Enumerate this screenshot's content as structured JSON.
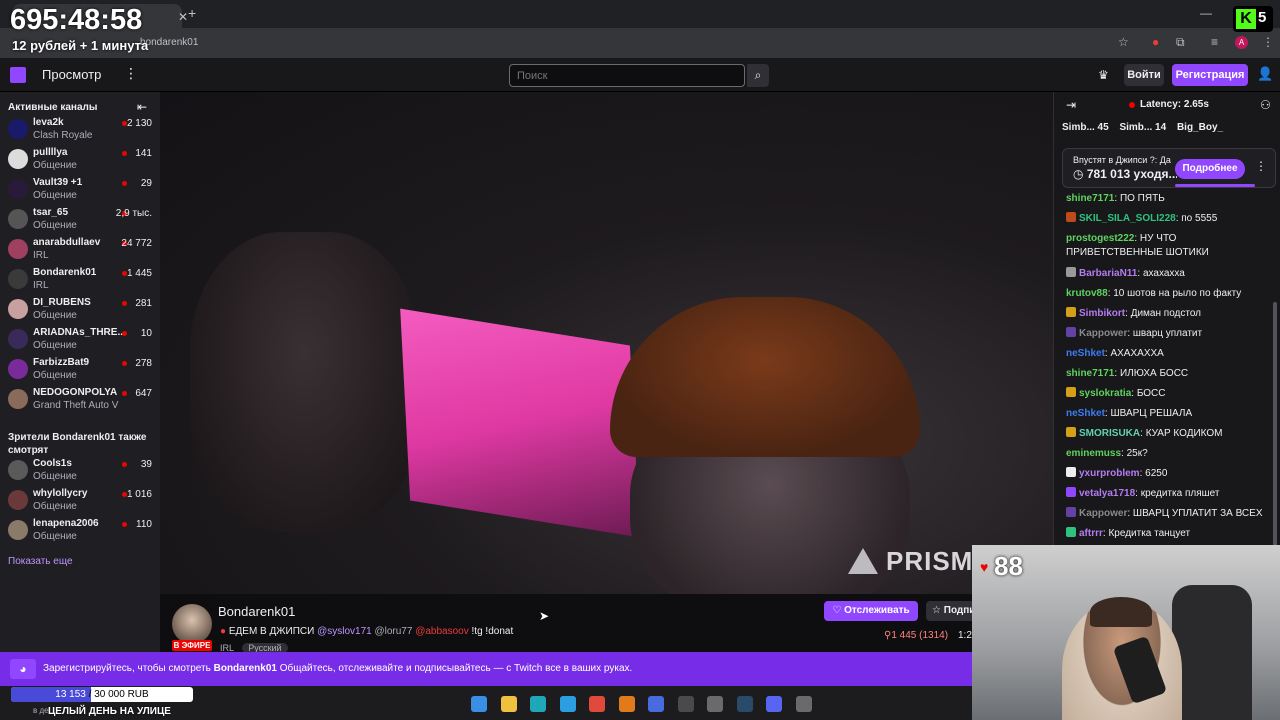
{
  "overlay": {
    "timer": "695:48:58",
    "rate": "12 рублей + 1 минута",
    "kick_count": "5",
    "kick_logo": "K",
    "likes": "88"
  },
  "browser": {
    "url": "bondarenk01",
    "icons": [
      "star-icon",
      "extension-icon",
      "puzzle-icon",
      "menu-icon"
    ],
    "avatar": "A"
  },
  "nav": {
    "browse": "Просмотр",
    "search_placeholder": "Поиск",
    "login": "Войти",
    "signup": "Регистрация"
  },
  "sidebar": {
    "title": "Активные каналы",
    "channels": [
      {
        "name": "leva2k",
        "category": "Clash Royale",
        "viewers": "2 130",
        "color": "#1a1a6a"
      },
      {
        "name": "pullllya",
        "category": "Общение",
        "viewers": "141",
        "color": "#dcdcdc"
      },
      {
        "name": "Vault39 +1",
        "category": "Общение",
        "viewers": "29",
        "color": "#2a1a3a"
      },
      {
        "name": "tsar_65",
        "category": "Общение",
        "viewers": "2,9 тыс.",
        "color": "#555"
      },
      {
        "name": "anarabdullaev",
        "category": "IRL",
        "viewers": "24 772",
        "color": "#a04060"
      },
      {
        "name": "Bondarenk01",
        "category": "IRL",
        "viewers": "1 445",
        "color": "#3a3a3a"
      },
      {
        "name": "DI_RUBENS",
        "category": "Общение",
        "viewers": "281",
        "color": "#c8a0a0"
      },
      {
        "name": "ARIADNAs_THRE...",
        "category": "Общение",
        "viewers": "10",
        "color": "#3a2a5a"
      },
      {
        "name": "FarbizzBat9",
        "category": "Общение",
        "viewers": "278",
        "color": "#7a2a9a"
      },
      {
        "name": "NEDOGONPOLYA",
        "category": "Grand Theft Auto V",
        "viewers": "647",
        "color": "#8a6a5a"
      }
    ],
    "title2": "Зрители Bondarenk01 также смотрят",
    "also": [
      {
        "name": "Cools1s",
        "category": "Общение",
        "viewers": "39",
        "color": "#5a5a5a"
      },
      {
        "name": "whylollycry",
        "category": "Общение",
        "viewers": "1 016",
        "color": "#6a3a3a"
      },
      {
        "name": "lenapena2006",
        "category": "Общение",
        "viewers": "110",
        "color": "#8a7a6a"
      }
    ],
    "show_more": "Показать еще"
  },
  "video": {
    "watermark": "PRISM"
  },
  "stream": {
    "channel": "Bondarenk01",
    "title_prefix": "ЕДЕМ В ДЖИПСИ",
    "mention1": "@syslov171",
    "mention2": "@loru77",
    "mention3": "@abbasoov",
    "title_suffix": "!tg !donat",
    "live": "В ЭФИРЕ",
    "tag_irl": "IRL",
    "tag_lang": "Русский",
    "follow": "Отслеживать",
    "subscribe": "Подписаться",
    "viewers": "1 445 (1314)",
    "uptime": "1:2"
  },
  "chat": {
    "latency": "Latency: 2.65s",
    "gifters": [
      "Simb... 45",
      "Simb... 14",
      "Big_Boy_"
    ],
    "prediction_question": "Впустят в Джипси ?: Да",
    "prediction_points": "781 013 уходя...",
    "prediction_button": "Подробнее",
    "messages": [
      {
        "user": "shine7171",
        "color": "#5fd35f",
        "text": "ПО ПЯТЬ",
        "badge": ""
      },
      {
        "user": "SKIL_SILA_SOLI228",
        "color": "#2ec27e",
        "text": "по 5555",
        "badge": "#c04a1a"
      },
      {
        "user": "prostogest222",
        "color": "#5fd35f",
        "text": "НУ ЧТО ПРИВЕТСТВЕННЫЕ ШОТИКИ",
        "badge": ""
      },
      {
        "user": "BarbariaN11",
        "color": "#b57cf0",
        "text": "ахахахха",
        "badge": "#999"
      },
      {
        "user": "krutov88",
        "color": "#5fd35f",
        "text": "10 шотов на рыло по факту",
        "badge": ""
      },
      {
        "user": "Simbikort",
        "color": "#b57cf0",
        "text": "Диман подстол",
        "badge": "#d4a017"
      },
      {
        "user": "Kappower",
        "color": "#8a8a8a",
        "text": "шварц уплатит",
        "badge": "#6441a5"
      },
      {
        "user": "neShket",
        "color": "#3c7cf0",
        "text": "АХАХАХХА",
        "badge": ""
      },
      {
        "user": "shine7171",
        "color": "#5fd35f",
        "text": "ИЛЮХА БОСС",
        "badge": ""
      },
      {
        "user": "syslokratia",
        "color": "#5fd35f",
        "text": "БОСС",
        "badge": "#d4a017"
      },
      {
        "user": "neShket",
        "color": "#3c7cf0",
        "text": "ШВАРЦ РЕШАЛА",
        "badge": ""
      },
      {
        "user": "SMORISUKA",
        "color": "#5fd3b0",
        "text": "КУАР КОДИКОМ",
        "badge": "#d4a017"
      },
      {
        "user": "eminemuss",
        "color": "#5fd35f",
        "text": "25к?",
        "badge": ""
      },
      {
        "user": "yxurproblem",
        "color": "#b57cf0",
        "text": "6250",
        "badge": "#eee"
      },
      {
        "user": "vetalya1718",
        "color": "#b57cf0",
        "text": "кредитка пляшет",
        "badge": "#9147ff"
      },
      {
        "user": "Kappower",
        "color": "#8a8a8a",
        "text": "ШВАРЦ УПЛАТИТ ЗА ВСЕХ",
        "badge": "#6441a5"
      },
      {
        "user": "aftrrr",
        "color": "#b57cf0",
        "text": "Кредитка танцует",
        "badge": "#2ec27e"
      }
    ]
  },
  "banner": {
    "text_pre": "Зарегистрируйтесь, чтобы смотреть ",
    "text_channel": "Bondarenk01",
    "text_post": " Общайтесь, отслеживайте и подписывайтесь — с Twitch все в ваших руках."
  },
  "goal": {
    "current": "13 153",
    "target": "30 000 RUB",
    "progress": 0.438
  },
  "ticker": {
    "prefix": "в де",
    "text": "ЦЕЛЫЙ ДЕНЬ НА УЛИЦЕ"
  },
  "taskbar": {
    "apps": [
      {
        "name": "windows-start-icon",
        "color": "#3a8ee6"
      },
      {
        "name": "file-explorer-icon",
        "color": "#f0c040"
      },
      {
        "name": "edge-icon",
        "color": "#1fa6b8"
      },
      {
        "name": "telegram-icon",
        "color": "#2a9ee0"
      },
      {
        "name": "chrome-icon",
        "color": "#e04a3a"
      },
      {
        "name": "app-orange-icon",
        "color": "#e07a1a"
      },
      {
        "name": "chart-app-icon",
        "color": "#4a6ae0"
      },
      {
        "name": "obs-icon",
        "color": "#4a4a4a"
      },
      {
        "name": "web-app-icon",
        "color": "#6a6a6a"
      },
      {
        "name": "steam-icon",
        "color": "#2a4a6a"
      },
      {
        "name": "discord-icon",
        "color": "#5865f2"
      },
      {
        "name": "calculator-icon",
        "color": "#6a6a6a"
      }
    ]
  }
}
